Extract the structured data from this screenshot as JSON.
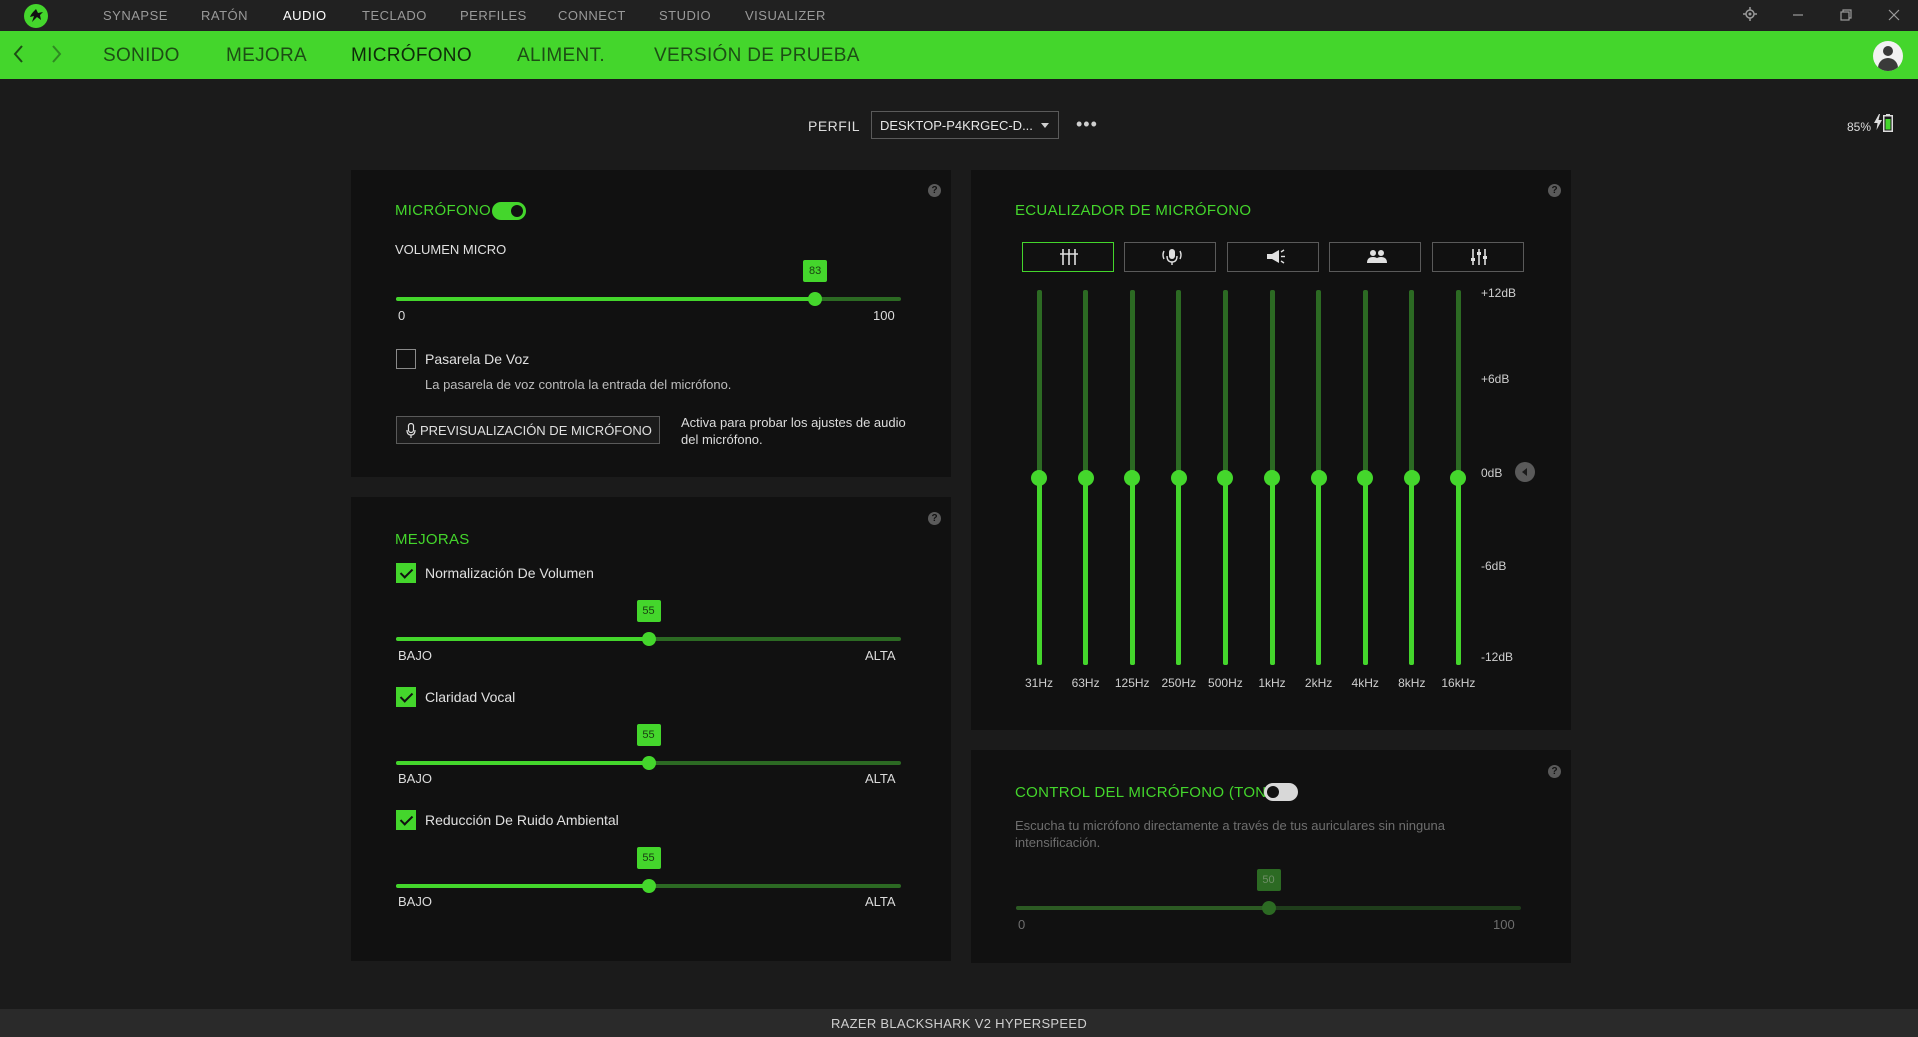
{
  "top_nav": [
    "SYNAPSE",
    "RATÓN",
    "AUDIO",
    "TECLADO",
    "PERFILES",
    "CONNECT",
    "STUDIO",
    "VISUALIZER"
  ],
  "tabs": [
    "SONIDO",
    "MEJORA",
    "MICRÓFONO",
    "ALIMENT.",
    "VERSIÓN DE PRUEBA"
  ],
  "profile": {
    "label": "PERFIL",
    "value": "DESKTOP-P4KRGEC-D...",
    "more": "•••"
  },
  "battery": {
    "text": "85%"
  },
  "mic": {
    "title": "MICRÓFONO",
    "enabled": true,
    "volume_label": "VOLUMEN MICRO",
    "volume_value": "83",
    "volume_fraction": 0.83,
    "min": "0",
    "max": "100",
    "voice_gate_label": "Pasarela De Voz",
    "voice_gate_checked": false,
    "voice_gate_desc": "La pasarela de voz controla la entrada del micrófono.",
    "preview_button": "PREVISUALIZACIÓN DE MICRÓFONO",
    "preview_desc": "Activa para probar los ajustes de audio del micrófono."
  },
  "enhancements": {
    "title": "MEJORAS",
    "items": [
      {
        "label": "Normalización De Volumen",
        "checked": true,
        "value": "55",
        "fraction": 0.5,
        "low": "BAJO",
        "high": "ALTA"
      },
      {
        "label": "Claridad Vocal",
        "checked": true,
        "value": "55",
        "fraction": 0.5,
        "low": "BAJO",
        "high": "ALTA"
      },
      {
        "label": "Reducción De Ruido Ambiental",
        "checked": true,
        "value": "55",
        "fraction": 0.5,
        "low": "BAJO",
        "high": "ALTA"
      }
    ]
  },
  "eq": {
    "title": "ECUALIZADOR DE MICRÓFONO",
    "presets": [
      "custom-eq-icon",
      "broadcast-mic-icon",
      "megaphone-icon",
      "group-icon",
      "sliders-icon"
    ],
    "bands": [
      "31Hz",
      "63Hz",
      "125Hz",
      "250Hz",
      "500Hz",
      "1kHz",
      "2kHz",
      "4kHz",
      "8kHz",
      "16kHz"
    ],
    "gains_db": [
      0,
      0,
      0,
      0,
      0,
      0,
      0,
      0,
      0,
      0
    ],
    "db_labels": [
      "+12dB",
      "+6dB",
      "0dB",
      "-6dB",
      "-12dB"
    ]
  },
  "sidetone": {
    "title": "CONTROL DEL MICRÓFONO (TONO)",
    "enabled": false,
    "desc": "Escucha tu micrófono directamente a través de tus auriculares sin ninguna intensificación.",
    "value": "50",
    "fraction": 0.5,
    "min": "0",
    "max": "100"
  },
  "footer": {
    "device": "RAZER BLACKSHARK V2 HYPERSPEED"
  },
  "colors": {
    "accent": "#44d62c",
    "background": "#1b1b1b",
    "panel": "#111111"
  }
}
